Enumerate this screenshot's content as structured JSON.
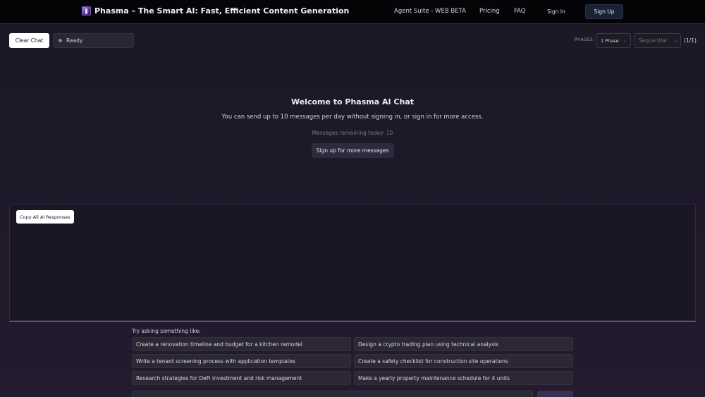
{
  "header": {
    "brand_title": "Phasma – The Smart AI: Fast, Efficient Content Generation",
    "nav": [
      "Agent Suite - WEB BETA",
      "Pricing",
      "FAQ"
    ],
    "sign_in": "Sign In",
    "sign_up": "Sign Up"
  },
  "toolbar": {
    "clear_chat": "Clear Chat",
    "status": "Ready",
    "phases_label": "PHASES:",
    "phase_value": "1 Phase",
    "mode_value": "Sequential",
    "count": "(1/1)"
  },
  "welcome": {
    "title": "Welcome to Phasma AI Chat",
    "description": "You can send up to 10 messages per day without signing in, or sign in for more access.",
    "remaining": "Messages remaining today: 10",
    "signup_more": "Sign up for more messages"
  },
  "panel": {
    "copy_all": "Copy All AI Responses"
  },
  "suggestions": {
    "label": "Try asking something like:",
    "items": [
      "Create a renovation timeline and budget for a kitchen remodel",
      "Design a crypto trading plan using technical analysis",
      "Write a tenant screening process with application templates",
      "Create a safety checklist for construction site operations",
      "Research strategies for DeFi investment and risk management",
      "Make a yearly property maintenance schedule for 4 units"
    ]
  },
  "colors": {
    "background": "#1e1929",
    "header": "#050507",
    "accent_button": "#2e2a3c"
  },
  "icons": [
    "phasma-logo-icon",
    "status-dot-icon",
    "chevron-down-icon"
  ]
}
